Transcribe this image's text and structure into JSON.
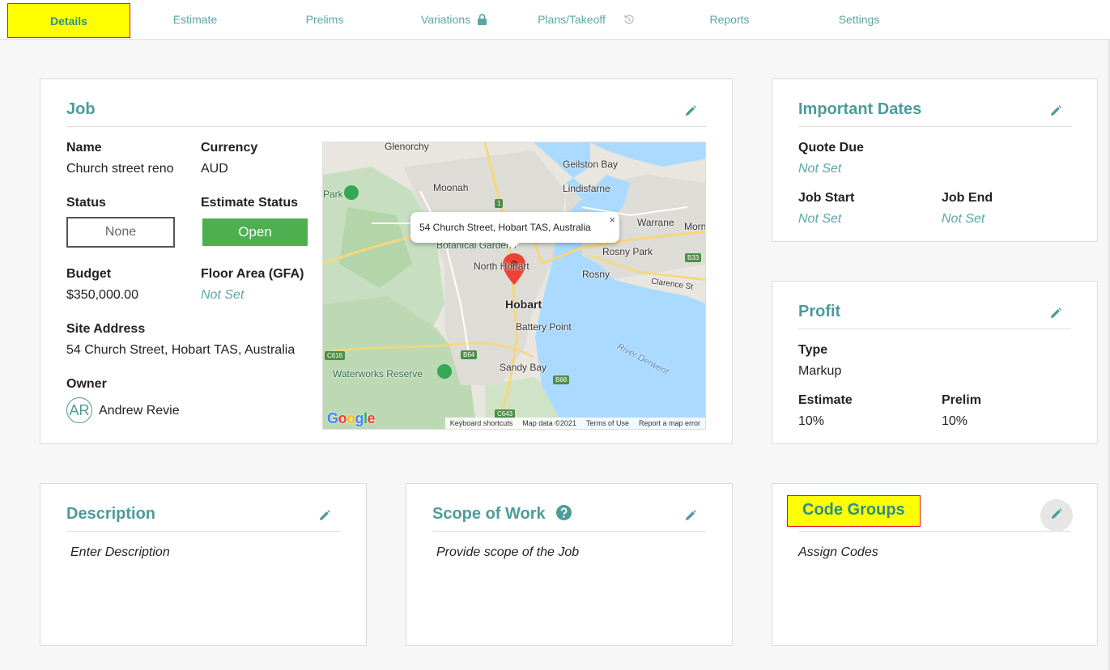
{
  "tabs": [
    {
      "label": "Details",
      "active": true
    },
    {
      "label": "Estimate"
    },
    {
      "label": "Prelims"
    },
    {
      "label": "Variations",
      "icon": "lock-icon"
    },
    {
      "label": "Plans/Takeoff",
      "icon": "history-icon"
    },
    {
      "label": "Reports"
    },
    {
      "label": "Settings"
    }
  ],
  "job": {
    "title": "Job",
    "name_label": "Name",
    "name": "Church street reno",
    "currency_label": "Currency",
    "currency": "AUD",
    "status_label": "Status",
    "status": "None",
    "estimate_status_label": "Estimate Status",
    "estimate_status": "Open",
    "budget_label": "Budget",
    "budget": "$350,000.00",
    "floor_area_label": "Floor Area (GFA)",
    "floor_area": "Not Set",
    "site_address_label": "Site Address",
    "site_address": "54 Church Street, Hobart TAS, Australia",
    "owner_label": "Owner",
    "owner_initials": "AR",
    "owner_name": "Andrew Revie"
  },
  "map": {
    "popup": "54 Church Street, Hobart TAS, Australia",
    "close": "×",
    "labels": {
      "glenorchy": "Glenorchy",
      "geilston_bay": "Geilston Bay",
      "moonah": "Moonah",
      "lindisfarne": "Lindisfarne",
      "park": "Park",
      "warrane": "Warrane",
      "morn": "Morn",
      "botanical": "Botanical Gardens",
      "rosny_park": "Rosny Park",
      "north_hobart": "North Hobart",
      "rosny": "Rosny",
      "clarence": "Clarence St",
      "hobart": "Hobart",
      "battery_point": "Battery Point",
      "river_derwent": "River Derwent",
      "waterworks": "Waterworks Reserve",
      "sandy_bay": "Sandy Bay"
    },
    "shields": [
      "1",
      "B33",
      "C616",
      "B64",
      "B68",
      "C643"
    ],
    "logo": "Google",
    "footer": [
      "Keyboard shortcuts",
      "Map data ©2021",
      "Terms of Use",
      "Report a map error"
    ]
  },
  "important_dates": {
    "title": "Important Dates",
    "quote_due_label": "Quote Due",
    "quote_due": "Not Set",
    "job_start_label": "Job Start",
    "job_start": "Not Set",
    "job_end_label": "Job End",
    "job_end": "Not Set"
  },
  "profit": {
    "title": "Profit",
    "type_label": "Type",
    "type": "Markup",
    "estimate_label": "Estimate",
    "estimate": "10%",
    "prelim_label": "Prelim",
    "prelim": "10%"
  },
  "description": {
    "title": "Description",
    "placeholder": "Enter Description"
  },
  "scope": {
    "title": "Scope of Work",
    "placeholder": "Provide scope of the Job"
  },
  "code_groups": {
    "title": "Code Groups",
    "placeholder": "Assign Codes"
  },
  "colors": {
    "accent": "#4c9c9b",
    "highlight": "#ffff00",
    "highlight_border": "#e0161b",
    "open_green": "#4caf50"
  }
}
